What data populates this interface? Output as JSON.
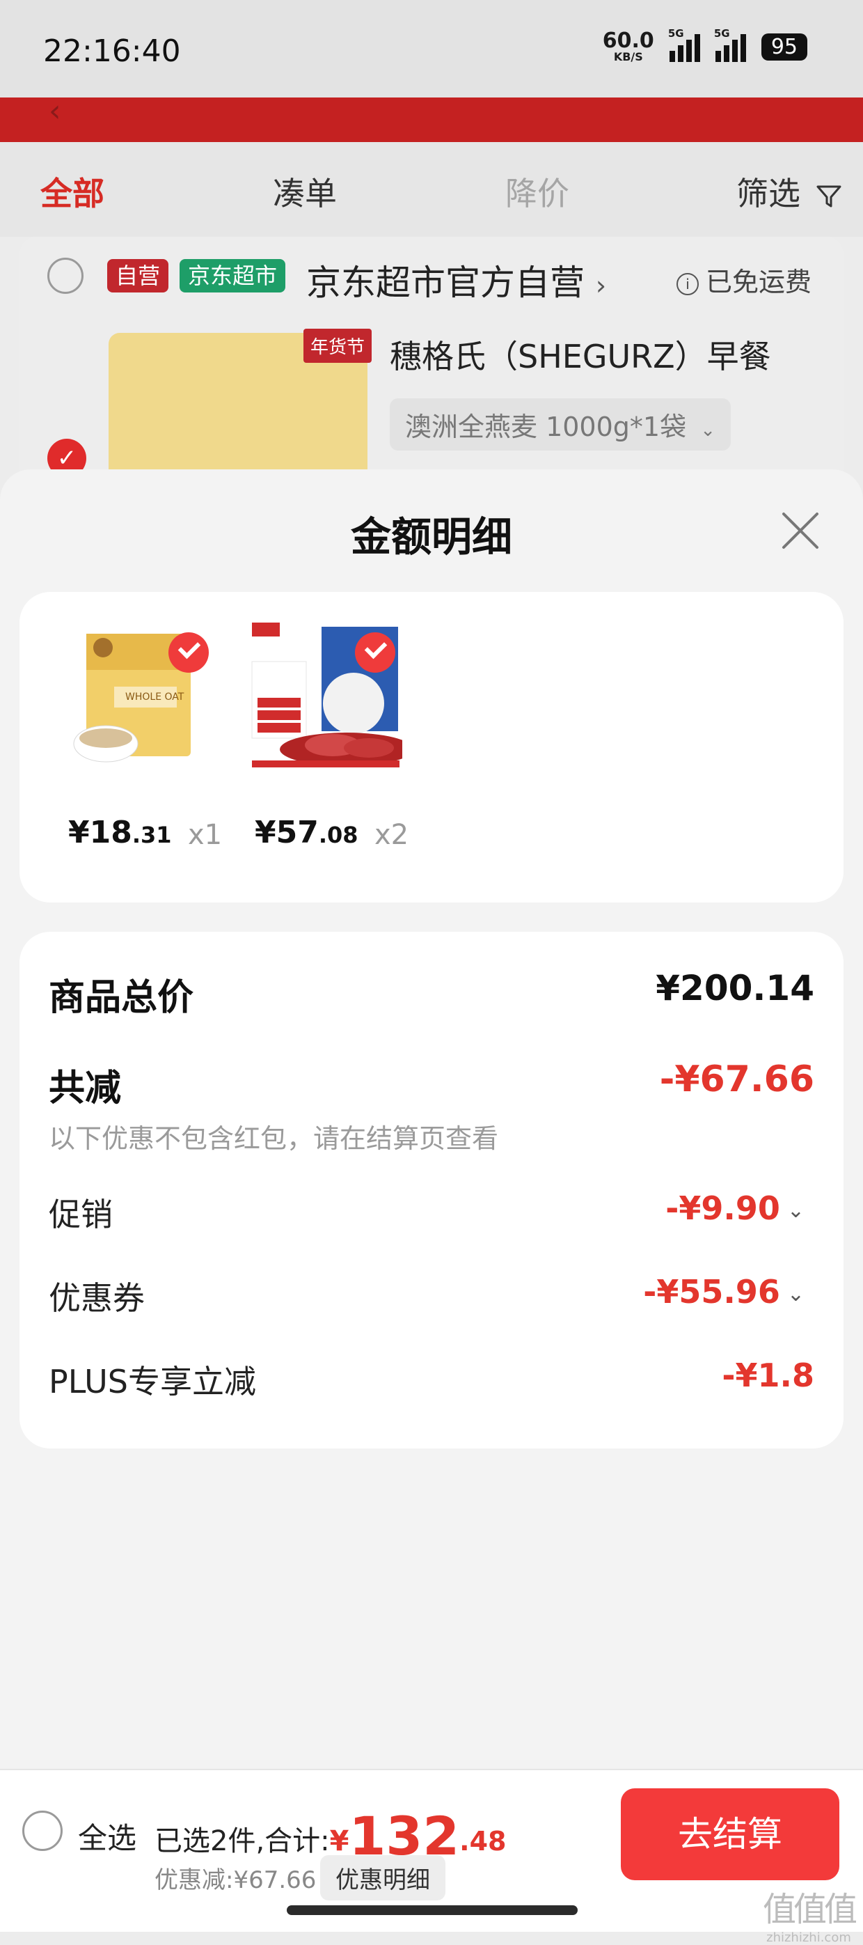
{
  "status_bar": {
    "time": "22:16:40",
    "net_speed": "60.0",
    "net_unit": "KB/S",
    "signal1": "5G",
    "signal2": "5G",
    "battery": "95"
  },
  "tabs": [
    {
      "label": "全部",
      "state": "active"
    },
    {
      "label": "凑单",
      "state": "normal"
    },
    {
      "label": "降价",
      "state": "disabled"
    },
    {
      "label": "筛选",
      "state": "normal"
    }
  ],
  "store": {
    "badge_self": "自营",
    "badge_market": "京东超市",
    "name": "京东超市官方自营",
    "free_shipping": "已免运费",
    "product_title": "穗格氏（SHEGURZ）早餐",
    "product_spec": "澳洲全燕麦 1000g*1袋",
    "festival_tag": "年货节",
    "pack_text": "WHOLE OAT"
  },
  "modal": {
    "title": "金额明细",
    "items": [
      {
        "price_int": "¥18",
        "price_dec": ".31",
        "qty": "x1"
      },
      {
        "price_int": "¥57",
        "price_dec": ".08",
        "qty": "x2"
      }
    ],
    "summary": {
      "total_label": "商品总价",
      "total_value": "¥200.14",
      "reduce_label": "共减",
      "reduce_value": "-¥67.66",
      "note": "以下优惠不包含红包，请在结算页查看",
      "lines": [
        {
          "label": "促销",
          "value": "-¥9.90",
          "expandable": true
        },
        {
          "label": "优惠券",
          "value": "-¥55.96",
          "expandable": true
        },
        {
          "label": "PLUS专享立减",
          "value": "-¥1.8",
          "expandable": false
        }
      ]
    }
  },
  "bottom_bar": {
    "select_all": "全选",
    "selected_prefix": "已选2件,合计:",
    "currency": "¥",
    "total_int": "132",
    "total_dec": ".48",
    "discount": "优惠减:¥67.66",
    "detail_button": "优惠明细",
    "checkout": "去结算"
  },
  "colors": {
    "accent": "#e3362d",
    "header": "#c42121",
    "checkout": "#f33a3a"
  },
  "icons": [
    "close-icon",
    "check-icon",
    "filter-icon",
    "info-icon",
    "chevron-down-icon",
    "chevron-right-icon"
  ]
}
